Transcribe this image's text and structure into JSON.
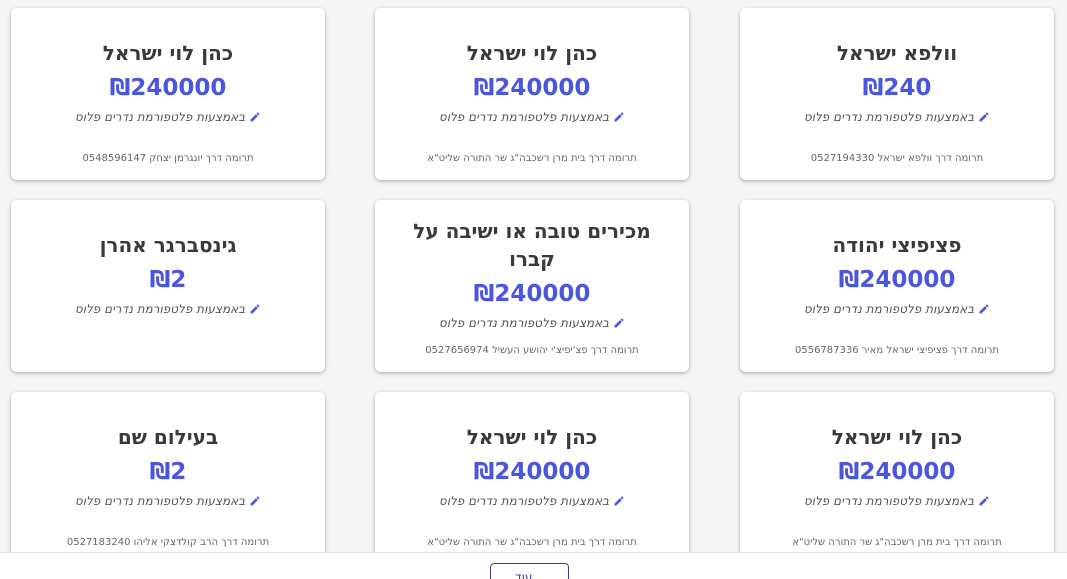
{
  "accent_color": "#4a56e2",
  "cards": [
    {
      "title": "וולפא ישראל",
      "amount": "₪240",
      "via": "באמצעות פלטפורמת נדרים פלוס",
      "footer": "תרומה דרך וולפא ישראל 0527194330"
    },
    {
      "title": "כהן לוי ישראל",
      "amount": "₪240000",
      "via": "באמצעות פלטפורמת נדרים פלוס",
      "footer": "תרומה דרך בית מרן רשכבה\"ג שר התורה שליט\"א"
    },
    {
      "title": "כהן לוי ישראל",
      "amount": "₪240000",
      "via": "באמצעות פלטפורמת נדרים פלוס",
      "footer": "תרומה דרך יונגרמן יצחק 0548596147"
    },
    {
      "title": "פציפיצי יהודה",
      "amount": "₪240000",
      "via": "באמצעות פלטפורמת נדרים פלוס",
      "footer": "תרומה דרך פציפיצי ישראל מאיר 0556787336"
    },
    {
      "title": "מכירים טובה או ישיבה על קברו",
      "amount": "₪240000",
      "via": "באמצעות פלטפורמת נדרים פלוס",
      "footer": "תרומה דרך פצ'יפיצ'י יהושע העשיל 0527656974"
    },
    {
      "title": "גינסברגר אהרן",
      "amount": "₪2",
      "via": "באמצעות פלטפורמת נדרים פלוס",
      "footer": ""
    },
    {
      "title": "כהן לוי ישראל",
      "amount": "₪240000",
      "via": "באמצעות פלטפורמת נדרים פלוס",
      "footer": "תרומה דרך בית מרן רשכבה\"ג שר התורה שליט\"א"
    },
    {
      "title": "כהן לוי ישראל",
      "amount": "₪240000",
      "via": "באמצעות פלטפורמת נדרים פלוס",
      "footer": "תרומה דרך בית מרן רשכבה\"ג שר התורה שליט\"א"
    },
    {
      "title": "בעילום שם",
      "amount": "₪2",
      "via": "באמצעות פלטפורמת נדרים פלוס",
      "footer": "תרומה דרך הרב קולדצקי אליהו 0527183240"
    }
  ],
  "load_more_label": "עוד..."
}
